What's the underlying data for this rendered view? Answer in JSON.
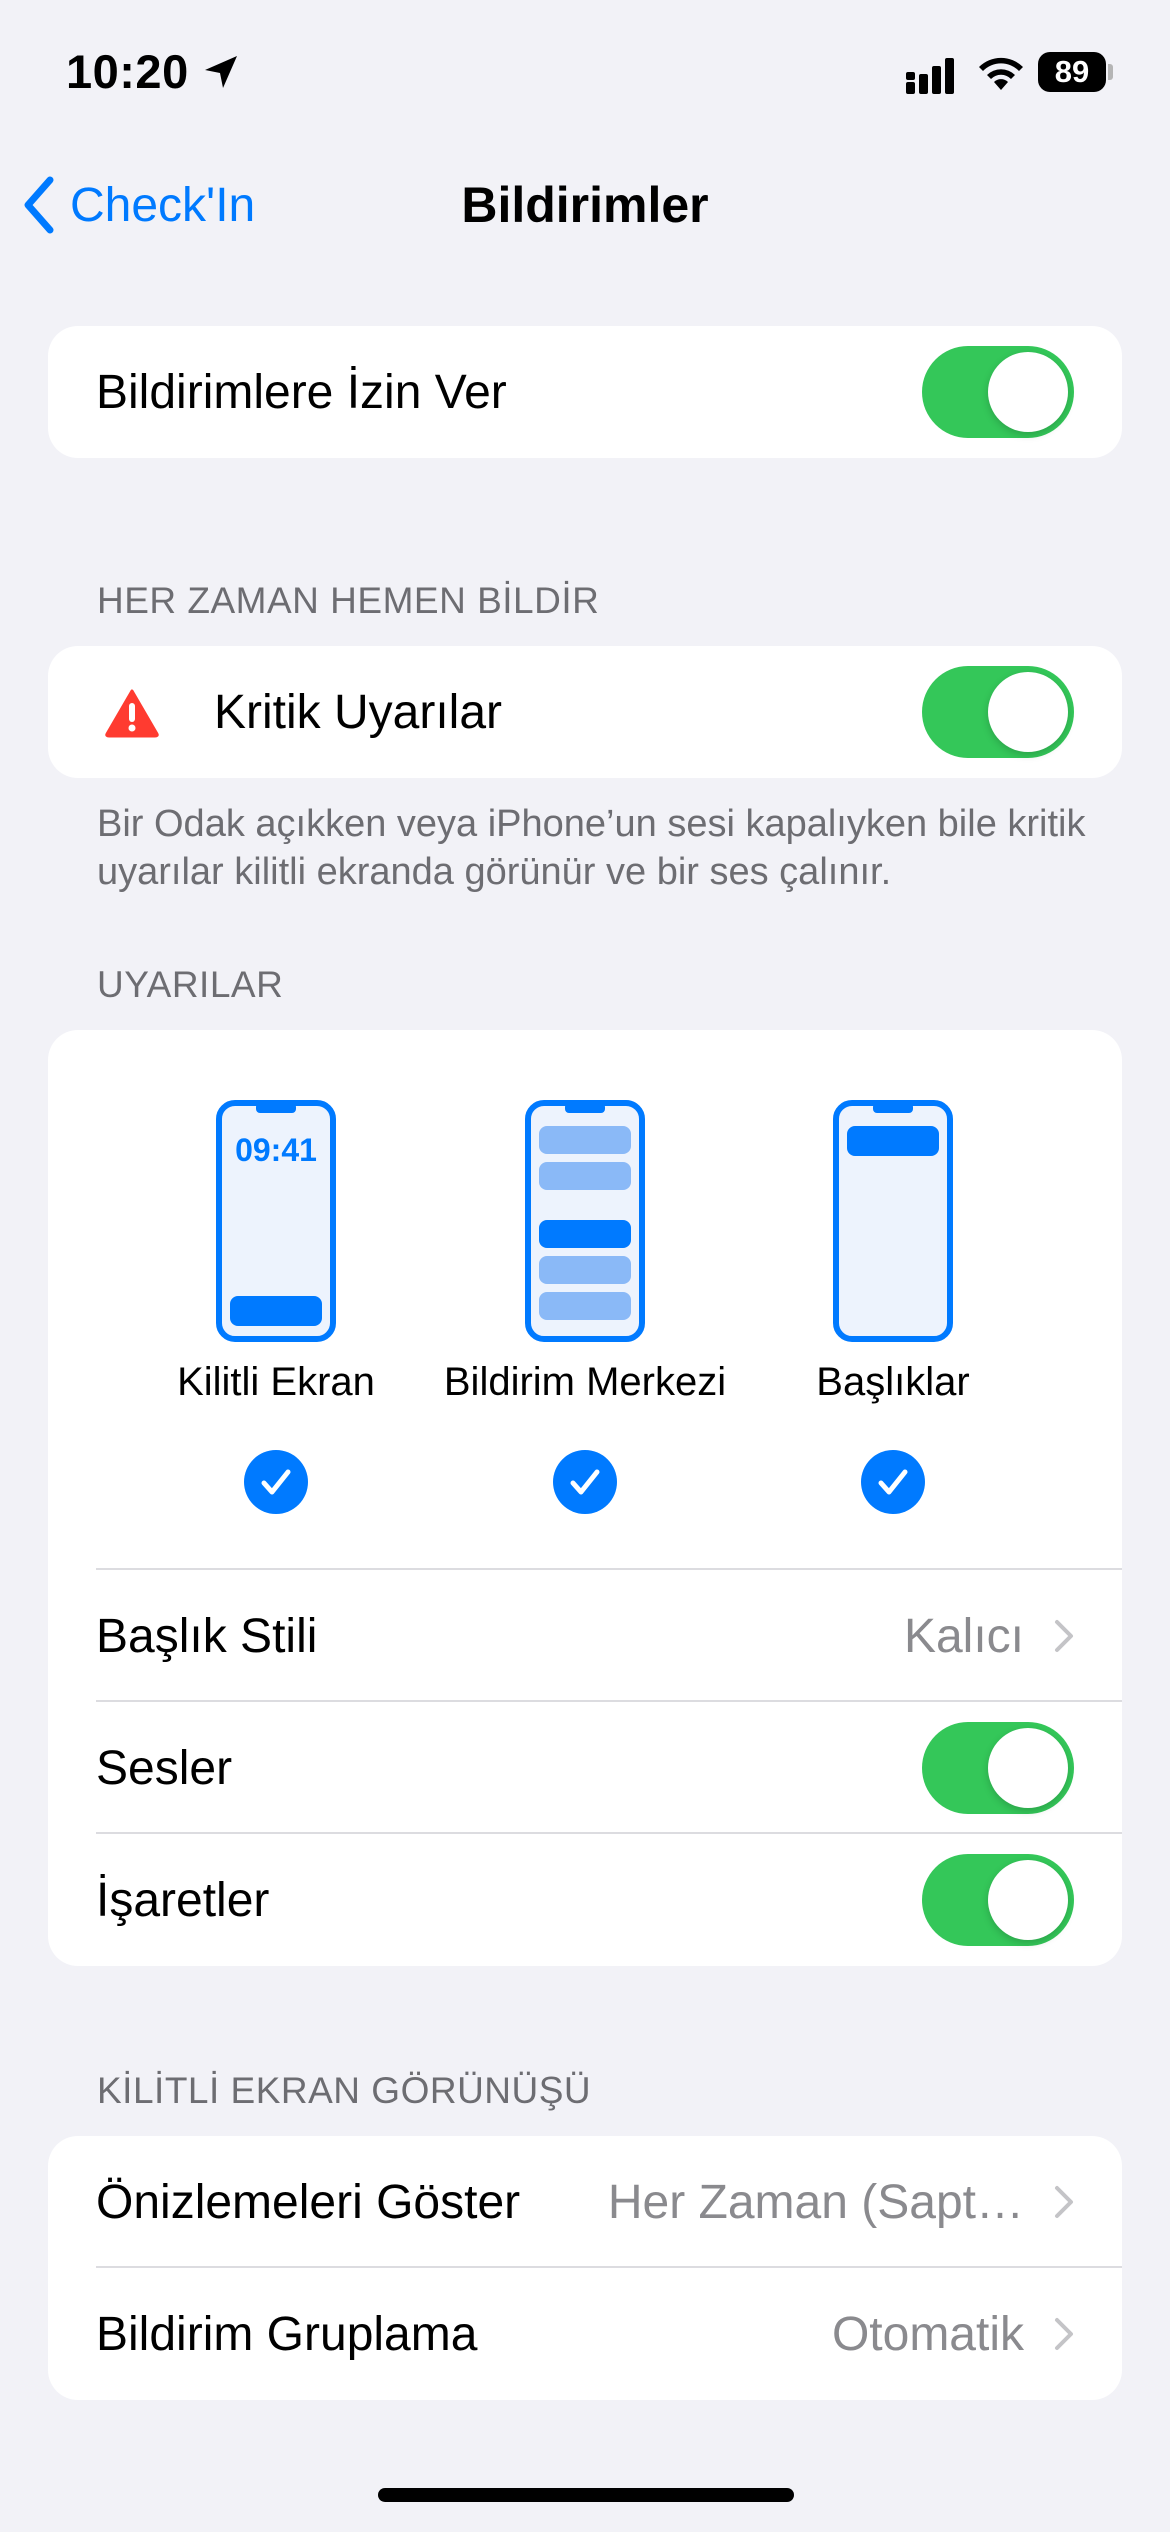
{
  "status_bar": {
    "time": "10:20",
    "battery": "89"
  },
  "nav": {
    "back_label": "Check'In",
    "title": "Bildirimler"
  },
  "allow": {
    "label": "Bildirimlere İzin Ver",
    "on": true
  },
  "critical": {
    "header": "HER ZAMAN HEMEN BİLDİR",
    "label": "Kritik Uyarılar",
    "on": true,
    "footer": "Bir Odak açıkken veya iPhone’un sesi kapalıyken bile kritik uyarılar kilitli ekranda görünür ve bir ses çalınır."
  },
  "alerts": {
    "header": "UYARILAR",
    "options": [
      {
        "label": "Kilitli Ekran",
        "clock": "09:41",
        "checked": true
      },
      {
        "label": "Bildirim Merkezi",
        "checked": true
      },
      {
        "label": "Başlıklar",
        "checked": true
      }
    ],
    "banner_style": {
      "label": "Başlık Stili",
      "value": "Kalıcı"
    },
    "sounds": {
      "label": "Sesler",
      "on": true
    },
    "badges": {
      "label": "İşaretler",
      "on": true
    }
  },
  "lock_screen": {
    "header": "KİLİTLİ EKRAN GÖRÜNÜŞÜ",
    "previews": {
      "label": "Önizlemeleri Göster",
      "value": "Her Zaman (Sapt…"
    },
    "grouping": {
      "label": "Bildirim Gruplama",
      "value": "Otomatik"
    }
  },
  "colors": {
    "accent": "#007aff",
    "toggle_on": "#34c759",
    "background": "#f2f2f7",
    "warning": "#ff3b30"
  },
  "icons": [
    "location-arrow-icon",
    "cellular-signal-icon",
    "wifi-icon",
    "battery-icon",
    "chevron-left-icon",
    "warning-icon",
    "chevron-right-icon",
    "checkmark-icon"
  ]
}
